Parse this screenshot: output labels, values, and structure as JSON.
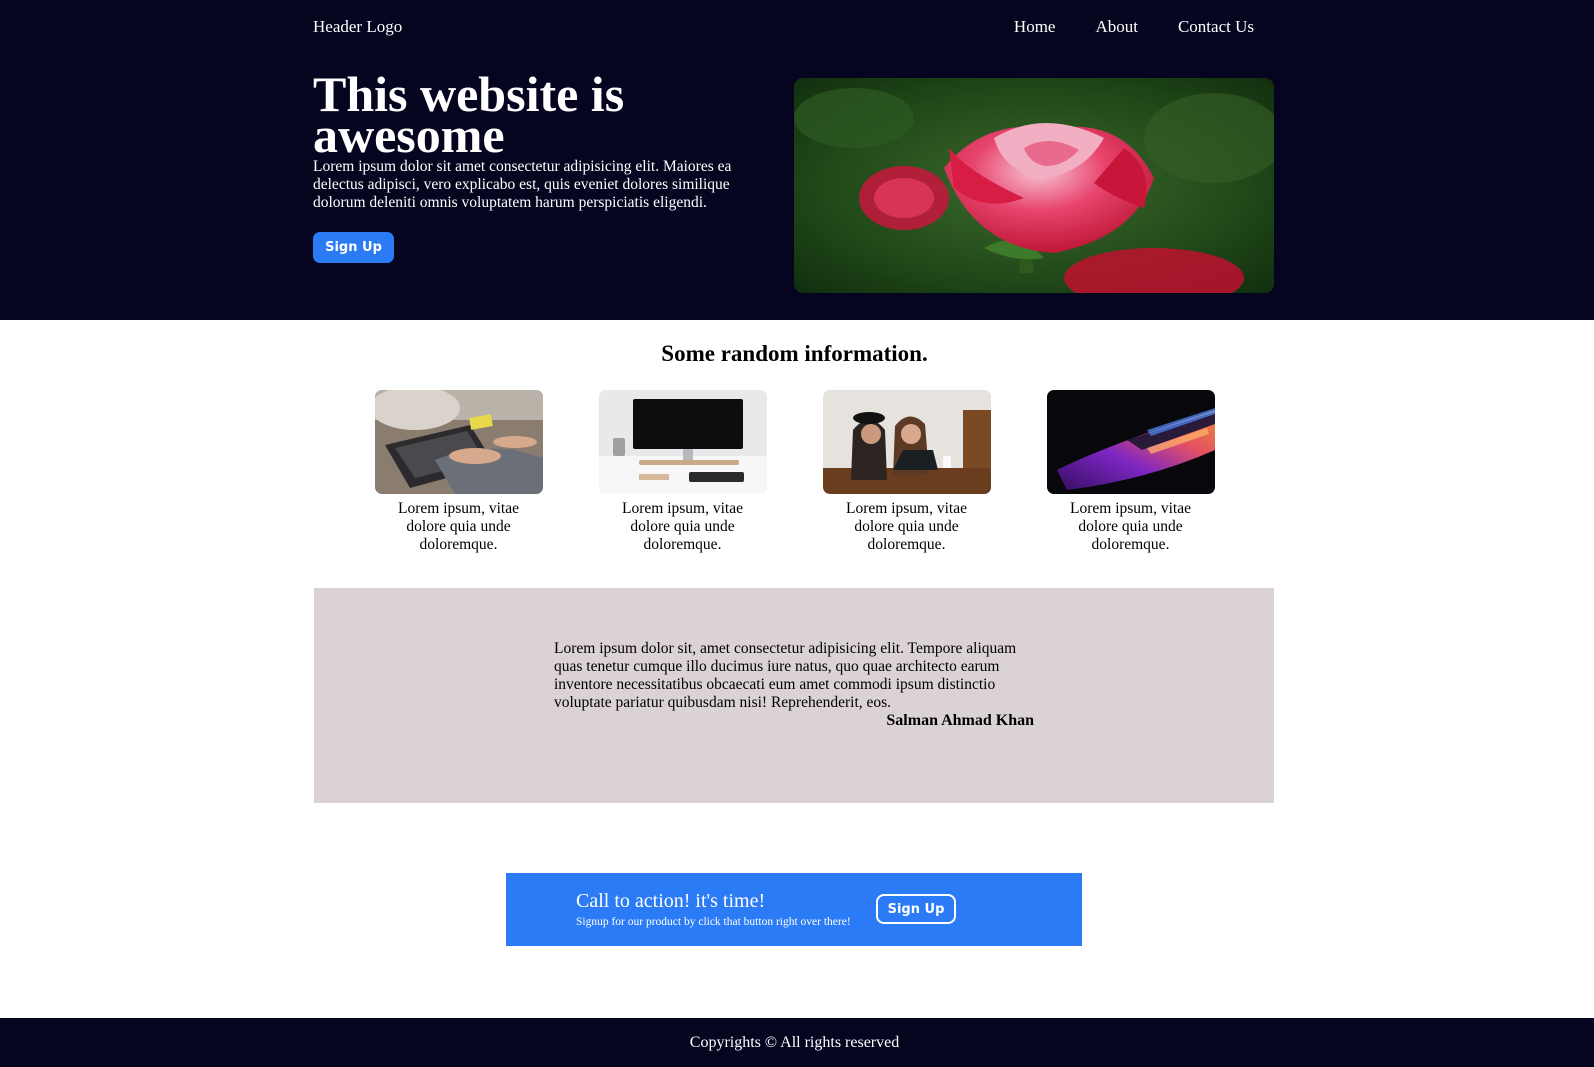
{
  "header": {
    "logo": "Header Logo",
    "nav": [
      "Home",
      "About",
      "Contact Us"
    ]
  },
  "hero": {
    "title": "This website is awesome",
    "text": "Lorem ipsum dolor sit amet consectetur adipisicing elit. Maiores ea delectus adipisci, vero explicabo est, quis eveniet dolores similique dolorum deleniti omnis voluptatem harum perspiciatis eligendi.",
    "button": "Sign Up",
    "image": "red-rose-photo"
  },
  "info": {
    "title": "Some random information.",
    "cards": [
      {
        "image": "laptop-typing-photo",
        "text": "Lorem ipsum, vitae dolore quia unde doloremque."
      },
      {
        "image": "desk-monitor-photo",
        "text": "Lorem ipsum, vitae dolore quia unde doloremque."
      },
      {
        "image": "two-women-laptop-photo",
        "text": "Lorem ipsum, vitae dolore quia unde doloremque."
      },
      {
        "image": "glowing-laptop-photo",
        "text": "Lorem ipsum, vitae dolore quia unde doloremque."
      }
    ]
  },
  "testimonial": {
    "quote": "Lorem ipsum dolor sit, amet consectetur adipisicing elit. Tempore aliquam quas tenetur cumque illo ducimus iure natus, quo quae architecto earum inventore necessitatibus obcaecati eum amet commodi ipsum distinctio voluptate pariatur quibusdam nisi! Reprehenderit, eos.",
    "author": "Salman Ahmad Khan"
  },
  "cta": {
    "title": "Call to action! it's time!",
    "subtitle": "Signup for our product by click that button right over there!",
    "button": "Sign Up"
  },
  "footer": {
    "text": "Copyrights © All rights reserved"
  },
  "colors": {
    "dark_bg": "#05051f",
    "accent": "#2a7bf5",
    "testimonial_bg": "#dad2d3"
  }
}
